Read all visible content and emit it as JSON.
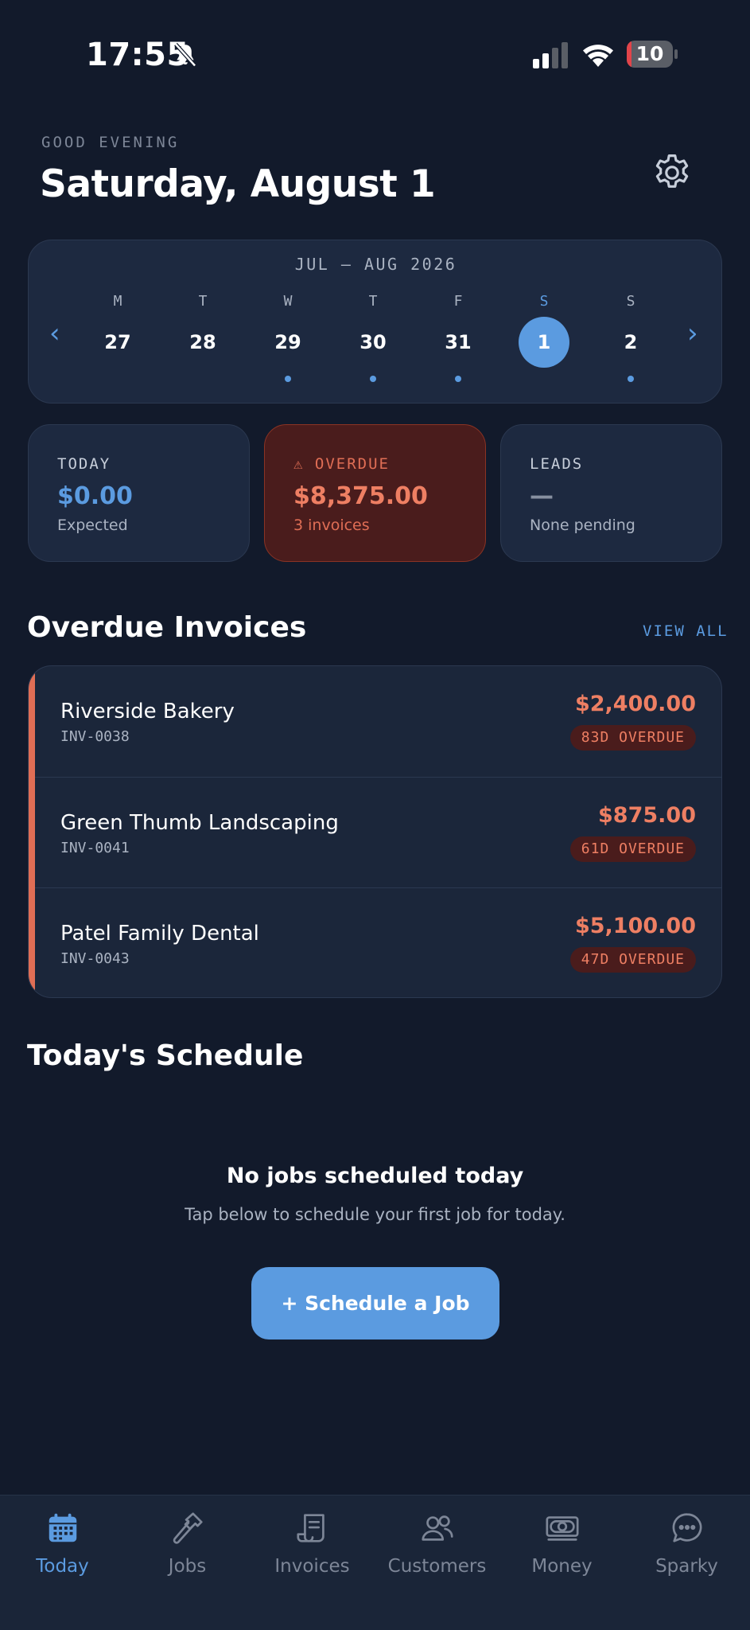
{
  "status_bar": {
    "time": "17:55",
    "battery": "10",
    "battery_level_percent": 10
  },
  "header": {
    "greeting": "GOOD EVENING",
    "title": "Saturday, August 1"
  },
  "calendar": {
    "range_label": "JUL – AUG 2026",
    "prev": "‹",
    "next": "›",
    "days": [
      {
        "dow": "M",
        "date": "27",
        "dot": false,
        "selected": false
      },
      {
        "dow": "T",
        "date": "28",
        "dot": false,
        "selected": false
      },
      {
        "dow": "W",
        "date": "29",
        "dot": true,
        "selected": false
      },
      {
        "dow": "T",
        "date": "30",
        "dot": true,
        "selected": false
      },
      {
        "dow": "F",
        "date": "31",
        "dot": true,
        "selected": false
      },
      {
        "dow": "S",
        "date": "1",
        "dot": false,
        "selected": true
      },
      {
        "dow": "S",
        "date": "2",
        "dot": true,
        "selected": false
      }
    ]
  },
  "stats": {
    "today": {
      "label": "TODAY",
      "value": "$0.00",
      "sub": "Expected"
    },
    "overdue": {
      "label": "⚠ OVERDUE",
      "value": "$8,375.00",
      "sub": "3 invoices"
    },
    "leads": {
      "label": "LEADS",
      "value": "—",
      "sub": "None pending"
    }
  },
  "overdue_section": {
    "title": "Overdue Invoices",
    "view_all": "VIEW ALL",
    "invoices": [
      {
        "name": "Riverside Bakery",
        "number": "INV-0038",
        "amount": "$2,400.00",
        "badge": "83D OVERDUE"
      },
      {
        "name": "Green Thumb Landscaping",
        "number": "INV-0041",
        "amount": "$875.00",
        "badge": "61D OVERDUE"
      },
      {
        "name": "Patel Family Dental",
        "number": "INV-0043",
        "amount": "$5,100.00",
        "badge": "47D OVERDUE"
      }
    ]
  },
  "schedule": {
    "title": "Today's Schedule",
    "empty_title": "No jobs scheduled today",
    "empty_sub": "Tap below to schedule your first job for today.",
    "button": "+ Schedule a Job"
  },
  "tabs": [
    {
      "label": "Today",
      "icon": "calendar-icon",
      "active": true
    },
    {
      "label": "Jobs",
      "icon": "hammer-icon",
      "active": false
    },
    {
      "label": "Invoices",
      "icon": "invoice-icon",
      "active": false
    },
    {
      "label": "Customers",
      "icon": "customers-icon",
      "active": false
    },
    {
      "label": "Money",
      "icon": "money-icon",
      "active": false
    },
    {
      "label": "Sparky",
      "icon": "chat-icon",
      "active": false
    }
  ],
  "colors": {
    "background": "#121a2b",
    "card": "#1d2940",
    "accent": "#5b9be0",
    "overdue": "#ee7f63",
    "overdue_bg": "#4a1c1c"
  }
}
